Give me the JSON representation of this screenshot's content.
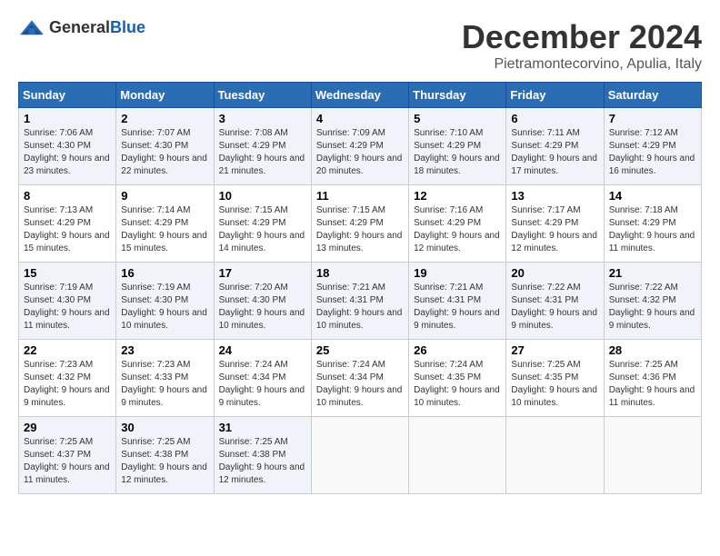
{
  "header": {
    "logo_general": "General",
    "logo_blue": "Blue",
    "month_title": "December 2024",
    "location": "Pietramontecorvino, Apulia, Italy"
  },
  "weekdays": [
    "Sunday",
    "Monday",
    "Tuesday",
    "Wednesday",
    "Thursday",
    "Friday",
    "Saturday"
  ],
  "weeks": [
    [
      {
        "day": "1",
        "sunrise": "7:06 AM",
        "sunset": "4:30 PM",
        "daylight": "9 hours and 23 minutes."
      },
      {
        "day": "2",
        "sunrise": "7:07 AM",
        "sunset": "4:30 PM",
        "daylight": "9 hours and 22 minutes."
      },
      {
        "day": "3",
        "sunrise": "7:08 AM",
        "sunset": "4:29 PM",
        "daylight": "9 hours and 21 minutes."
      },
      {
        "day": "4",
        "sunrise": "7:09 AM",
        "sunset": "4:29 PM",
        "daylight": "9 hours and 20 minutes."
      },
      {
        "day": "5",
        "sunrise": "7:10 AM",
        "sunset": "4:29 PM",
        "daylight": "9 hours and 18 minutes."
      },
      {
        "day": "6",
        "sunrise": "7:11 AM",
        "sunset": "4:29 PM",
        "daylight": "9 hours and 17 minutes."
      },
      {
        "day": "7",
        "sunrise": "7:12 AM",
        "sunset": "4:29 PM",
        "daylight": "9 hours and 16 minutes."
      }
    ],
    [
      {
        "day": "8",
        "sunrise": "7:13 AM",
        "sunset": "4:29 PM",
        "daylight": "9 hours and 15 minutes."
      },
      {
        "day": "9",
        "sunrise": "7:14 AM",
        "sunset": "4:29 PM",
        "daylight": "9 hours and 15 minutes."
      },
      {
        "day": "10",
        "sunrise": "7:15 AM",
        "sunset": "4:29 PM",
        "daylight": "9 hours and 14 minutes."
      },
      {
        "day": "11",
        "sunrise": "7:15 AM",
        "sunset": "4:29 PM",
        "daylight": "9 hours and 13 minutes."
      },
      {
        "day": "12",
        "sunrise": "7:16 AM",
        "sunset": "4:29 PM",
        "daylight": "9 hours and 12 minutes."
      },
      {
        "day": "13",
        "sunrise": "7:17 AM",
        "sunset": "4:29 PM",
        "daylight": "9 hours and 12 minutes."
      },
      {
        "day": "14",
        "sunrise": "7:18 AM",
        "sunset": "4:29 PM",
        "daylight": "9 hours and 11 minutes."
      }
    ],
    [
      {
        "day": "15",
        "sunrise": "7:19 AM",
        "sunset": "4:30 PM",
        "daylight": "9 hours and 11 minutes."
      },
      {
        "day": "16",
        "sunrise": "7:19 AM",
        "sunset": "4:30 PM",
        "daylight": "9 hours and 10 minutes."
      },
      {
        "day": "17",
        "sunrise": "7:20 AM",
        "sunset": "4:30 PM",
        "daylight": "9 hours and 10 minutes."
      },
      {
        "day": "18",
        "sunrise": "7:21 AM",
        "sunset": "4:31 PM",
        "daylight": "9 hours and 10 minutes."
      },
      {
        "day": "19",
        "sunrise": "7:21 AM",
        "sunset": "4:31 PM",
        "daylight": "9 hours and 9 minutes."
      },
      {
        "day": "20",
        "sunrise": "7:22 AM",
        "sunset": "4:31 PM",
        "daylight": "9 hours and 9 minutes."
      },
      {
        "day": "21",
        "sunrise": "7:22 AM",
        "sunset": "4:32 PM",
        "daylight": "9 hours and 9 minutes."
      }
    ],
    [
      {
        "day": "22",
        "sunrise": "7:23 AM",
        "sunset": "4:32 PM",
        "daylight": "9 hours and 9 minutes."
      },
      {
        "day": "23",
        "sunrise": "7:23 AM",
        "sunset": "4:33 PM",
        "daylight": "9 hours and 9 minutes."
      },
      {
        "day": "24",
        "sunrise": "7:24 AM",
        "sunset": "4:34 PM",
        "daylight": "9 hours and 9 minutes."
      },
      {
        "day": "25",
        "sunrise": "7:24 AM",
        "sunset": "4:34 PM",
        "daylight": "9 hours and 10 minutes."
      },
      {
        "day": "26",
        "sunrise": "7:24 AM",
        "sunset": "4:35 PM",
        "daylight": "9 hours and 10 minutes."
      },
      {
        "day": "27",
        "sunrise": "7:25 AM",
        "sunset": "4:35 PM",
        "daylight": "9 hours and 10 minutes."
      },
      {
        "day": "28",
        "sunrise": "7:25 AM",
        "sunset": "4:36 PM",
        "daylight": "9 hours and 11 minutes."
      }
    ],
    [
      {
        "day": "29",
        "sunrise": "7:25 AM",
        "sunset": "4:37 PM",
        "daylight": "9 hours and 11 minutes."
      },
      {
        "day": "30",
        "sunrise": "7:25 AM",
        "sunset": "4:38 PM",
        "daylight": "9 hours and 12 minutes."
      },
      {
        "day": "31",
        "sunrise": "7:25 AM",
        "sunset": "4:38 PM",
        "daylight": "9 hours and 12 minutes."
      },
      null,
      null,
      null,
      null
    ]
  ],
  "labels": {
    "sunrise": "Sunrise:",
    "sunset": "Sunset:",
    "daylight": "Daylight:"
  }
}
